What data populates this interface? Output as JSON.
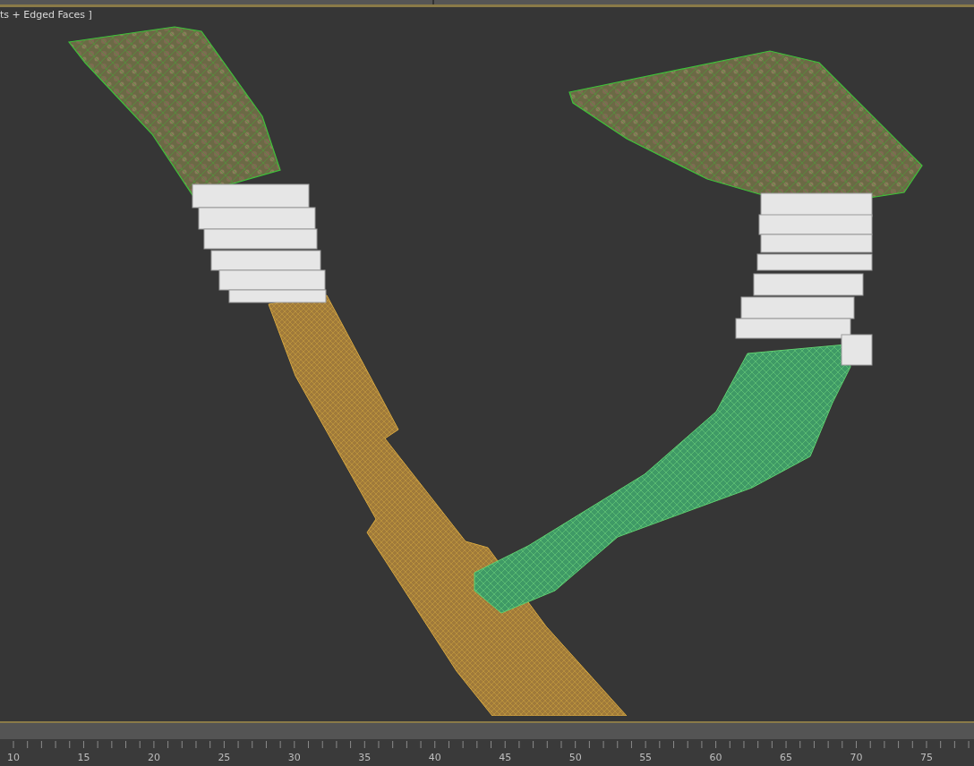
{
  "viewport": {
    "label": "ts + Edged Faces ]"
  },
  "timeline": {
    "frame_labels": [
      "10",
      "15",
      "20",
      "25",
      "30",
      "35",
      "40",
      "45",
      "50",
      "55",
      "60",
      "65",
      "70",
      "75"
    ]
  }
}
